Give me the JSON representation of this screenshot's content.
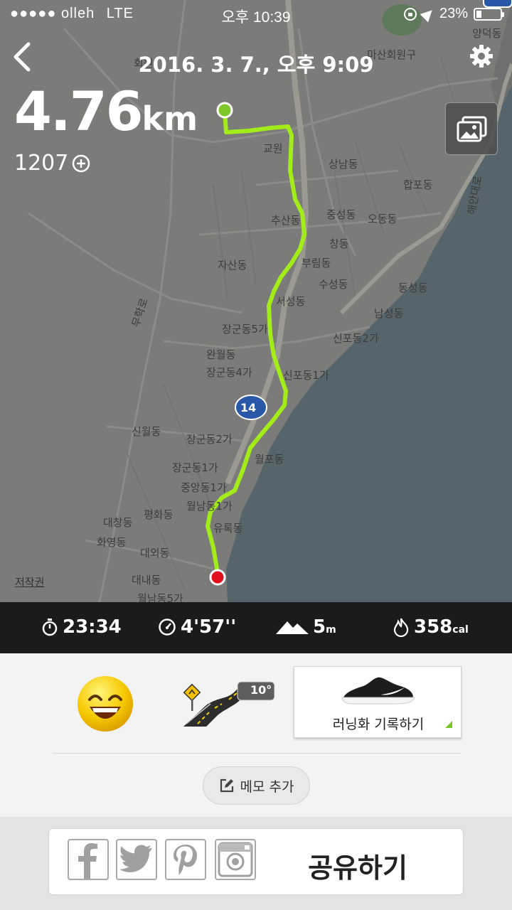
{
  "status_bar": {
    "carrier": "●●●●● olleh",
    "network": "LTE",
    "time": "오후 10:39",
    "battery": "23%",
    "battery_level": 0.23
  },
  "header": {
    "title": "2016. 3. 7., 오후 9:09"
  },
  "summary": {
    "distance": "4.76",
    "distance_unit": "km",
    "fuel": "1207"
  },
  "map": {
    "copyright": "저작권",
    "route_color": "#9fe11c",
    "start_color": "#7ec72a",
    "end_color": "#e0101c",
    "road_badge": "14",
    "labels": [
      "회원",
      "마산회원구",
      "양덕동",
      "교원",
      "상남동",
      "합포동",
      "중성동",
      "오동동",
      "추산동",
      "창동",
      "부림동",
      "자산동",
      "수성동",
      "동성동",
      "서성동",
      "남성동",
      "무학로",
      "장군동5가",
      "신포동2가",
      "완월동",
      "장군동4가",
      "신포동1가",
      "신월동",
      "장군동2가",
      "월포동",
      "장군동1가",
      "중앙동1가",
      "월남동1가",
      "평화동",
      "대창동",
      "유록동",
      "화영동",
      "대외동",
      "대내동",
      "월남동5가",
      "해안대로"
    ]
  },
  "stats": {
    "duration": "23:34",
    "pace": "4'57''",
    "elevation": "5",
    "elevation_unit": "m",
    "calories": "358",
    "calories_unit": "cal"
  },
  "details": {
    "mood": "happy",
    "terrain": "road",
    "time_of_day": "night",
    "temperature": "10°",
    "shoe_label": "러닝화 기록하기",
    "memo_label": "메모 추가"
  },
  "share": {
    "label": "공유하기",
    "icons": [
      "facebook-icon",
      "twitter-icon",
      "pinterest-icon",
      "instagram-icon"
    ]
  }
}
